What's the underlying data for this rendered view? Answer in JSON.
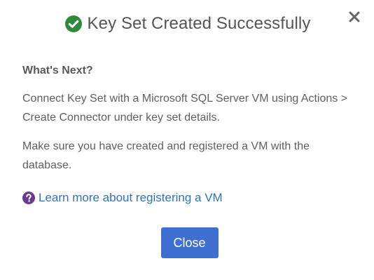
{
  "dialog": {
    "title": "Key Set Created Successfully",
    "section_heading": "What's Next?",
    "paragraph_1": "Connect Key Set with a Microsoft SQL Server VM using Actions > Create Connector under key set details.",
    "paragraph_2": "Make sure you have created and registered a VM with the database.",
    "learn_more_link": "Learn more about registering a VM",
    "close_button": "Close"
  },
  "icons": {
    "title_icon": "check-circle-icon",
    "dismiss_icon": "close-icon",
    "help_icon": "question-circle-icon"
  },
  "colors": {
    "success": "#2e8b3a",
    "link": "#2e72b8",
    "help_icon": "#6b3a8c",
    "primary_button": "#3f6fd1"
  }
}
